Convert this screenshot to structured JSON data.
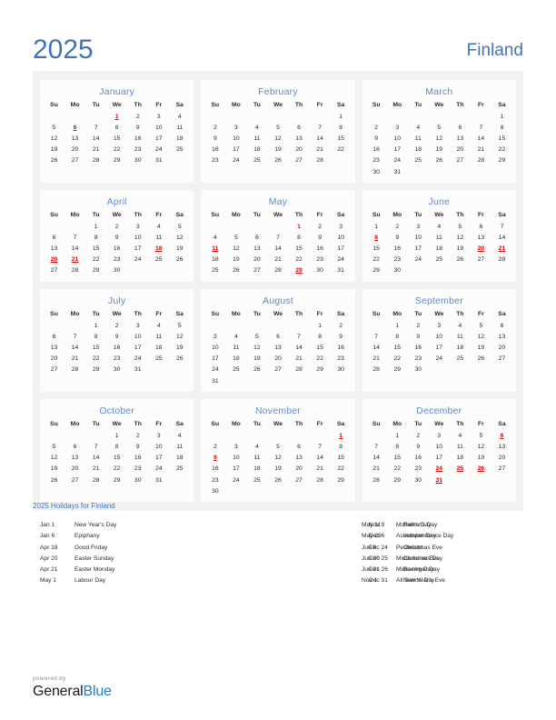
{
  "header": {
    "year": "2025",
    "country": "Finland"
  },
  "weekdays": [
    "Su",
    "Mo",
    "Tu",
    "We",
    "Th",
    "Fr",
    "Sa"
  ],
  "months": [
    {
      "name": "January",
      "weeks": [
        [
          "",
          "",
          "",
          "1",
          "2",
          "3",
          "4"
        ],
        [
          "5",
          "6",
          "7",
          "8",
          "9",
          "10",
          "11"
        ],
        [
          "12",
          "13",
          "14",
          "15",
          "16",
          "17",
          "18"
        ],
        [
          "19",
          "20",
          "21",
          "22",
          "23",
          "24",
          "25"
        ],
        [
          "26",
          "27",
          "28",
          "29",
          "30",
          "31",
          ""
        ]
      ],
      "holidays": [
        "1",
        "6"
      ],
      "holidays_plain": []
    },
    {
      "name": "February",
      "weeks": [
        [
          "",
          "",
          "",
          "",
          "",
          "",
          "1"
        ],
        [
          "2",
          "3",
          "4",
          "5",
          "6",
          "7",
          "8"
        ],
        [
          "9",
          "10",
          "11",
          "12",
          "13",
          "14",
          "15"
        ],
        [
          "16",
          "17",
          "18",
          "19",
          "20",
          "21",
          "22"
        ],
        [
          "23",
          "24",
          "25",
          "26",
          "27",
          "28",
          ""
        ]
      ],
      "holidays": [],
      "holidays_plain": []
    },
    {
      "name": "March",
      "weeks": [
        [
          "",
          "",
          "",
          "",
          "",
          "",
          "1"
        ],
        [
          "2",
          "3",
          "4",
          "5",
          "6",
          "7",
          "8"
        ],
        [
          "9",
          "10",
          "11",
          "12",
          "13",
          "14",
          "15"
        ],
        [
          "16",
          "17",
          "18",
          "19",
          "20",
          "21",
          "22"
        ],
        [
          "23",
          "24",
          "25",
          "26",
          "27",
          "28",
          "29"
        ],
        [
          "30",
          "31",
          "",
          "",
          "",
          "",
          ""
        ]
      ],
      "holidays": [],
      "holidays_plain": []
    },
    {
      "name": "April",
      "weeks": [
        [
          "",
          "",
          "1",
          "2",
          "3",
          "4",
          "5"
        ],
        [
          "6",
          "7",
          "8",
          "9",
          "10",
          "11",
          "12"
        ],
        [
          "13",
          "14",
          "15",
          "16",
          "17",
          "18",
          "19"
        ],
        [
          "20",
          "21",
          "22",
          "23",
          "24",
          "25",
          "26"
        ],
        [
          "27",
          "28",
          "29",
          "30",
          "",
          "",
          ""
        ]
      ],
      "holidays": [
        "18",
        "20",
        "21"
      ],
      "holidays_plain": []
    },
    {
      "name": "May",
      "weeks": [
        [
          "",
          "",
          "",
          "",
          "1",
          "2",
          "3"
        ],
        [
          "4",
          "5",
          "6",
          "7",
          "8",
          "9",
          "10"
        ],
        [
          "11",
          "12",
          "13",
          "14",
          "15",
          "16",
          "17"
        ],
        [
          "18",
          "19",
          "20",
          "21",
          "22",
          "23",
          "24"
        ],
        [
          "25",
          "26",
          "27",
          "28",
          "29",
          "30",
          "31"
        ]
      ],
      "holidays": [
        "11",
        "29"
      ],
      "holidays_plain": [
        "1"
      ]
    },
    {
      "name": "June",
      "weeks": [
        [
          "1",
          "2",
          "3",
          "4",
          "5",
          "6",
          "7"
        ],
        [
          "8",
          "9",
          "10",
          "11",
          "12",
          "13",
          "14"
        ],
        [
          "15",
          "16",
          "17",
          "18",
          "19",
          "20",
          "21"
        ],
        [
          "22",
          "23",
          "24",
          "25",
          "26",
          "27",
          "28"
        ],
        [
          "29",
          "30",
          "",
          "",
          "",
          "",
          ""
        ]
      ],
      "holidays": [
        "8",
        "20",
        "21"
      ],
      "holidays_plain": []
    },
    {
      "name": "July",
      "weeks": [
        [
          "",
          "",
          "1",
          "2",
          "3",
          "4",
          "5"
        ],
        [
          "6",
          "7",
          "8",
          "9",
          "10",
          "11",
          "12"
        ],
        [
          "13",
          "14",
          "15",
          "16",
          "17",
          "18",
          "19"
        ],
        [
          "20",
          "21",
          "22",
          "23",
          "24",
          "25",
          "26"
        ],
        [
          "27",
          "28",
          "29",
          "30",
          "31",
          "",
          ""
        ]
      ],
      "holidays": [],
      "holidays_plain": []
    },
    {
      "name": "August",
      "weeks": [
        [
          "",
          "",
          "",
          "",
          "",
          "1",
          "2"
        ],
        [
          "3",
          "4",
          "5",
          "6",
          "7",
          "8",
          "9"
        ],
        [
          "10",
          "11",
          "12",
          "13",
          "14",
          "15",
          "16"
        ],
        [
          "17",
          "18",
          "19",
          "20",
          "21",
          "22",
          "23"
        ],
        [
          "24",
          "25",
          "26",
          "27",
          "28",
          "29",
          "30"
        ],
        [
          "31",
          "",
          "",
          "",
          "",
          "",
          ""
        ]
      ],
      "holidays": [],
      "holidays_plain": []
    },
    {
      "name": "September",
      "weeks": [
        [
          "",
          "1",
          "2",
          "3",
          "4",
          "5",
          "6"
        ],
        [
          "7",
          "8",
          "9",
          "10",
          "11",
          "12",
          "13"
        ],
        [
          "14",
          "15",
          "16",
          "17",
          "18",
          "19",
          "20"
        ],
        [
          "21",
          "22",
          "23",
          "24",
          "25",
          "26",
          "27"
        ],
        [
          "28",
          "29",
          "30",
          "",
          "",
          "",
          ""
        ]
      ],
      "holidays": [],
      "holidays_plain": []
    },
    {
      "name": "October",
      "weeks": [
        [
          "",
          "",
          "",
          "1",
          "2",
          "3",
          "4"
        ],
        [
          "5",
          "6",
          "7",
          "8",
          "9",
          "10",
          "11"
        ],
        [
          "12",
          "13",
          "14",
          "15",
          "16",
          "17",
          "18"
        ],
        [
          "19",
          "20",
          "21",
          "22",
          "23",
          "24",
          "25"
        ],
        [
          "26",
          "27",
          "28",
          "29",
          "30",
          "31",
          ""
        ]
      ],
      "holidays": [],
      "holidays_plain": []
    },
    {
      "name": "November",
      "weeks": [
        [
          "",
          "",
          "",
          "",
          "",
          "",
          "1"
        ],
        [
          "2",
          "3",
          "4",
          "5",
          "6",
          "7",
          "8"
        ],
        [
          "9",
          "10",
          "11",
          "12",
          "13",
          "14",
          "15"
        ],
        [
          "16",
          "17",
          "18",
          "19",
          "20",
          "21",
          "22"
        ],
        [
          "23",
          "24",
          "25",
          "26",
          "27",
          "28",
          "29"
        ],
        [
          "30",
          "",
          "",
          "",
          "",
          "",
          ""
        ]
      ],
      "holidays": [
        "1",
        "9"
      ],
      "holidays_plain": []
    },
    {
      "name": "December",
      "weeks": [
        [
          "",
          "1",
          "2",
          "3",
          "4",
          "5",
          "6"
        ],
        [
          "7",
          "8",
          "9",
          "10",
          "11",
          "12",
          "13"
        ],
        [
          "14",
          "15",
          "16",
          "17",
          "18",
          "19",
          "20"
        ],
        [
          "21",
          "22",
          "23",
          "24",
          "25",
          "26",
          "27"
        ],
        [
          "28",
          "29",
          "30",
          "31",
          "",
          "",
          ""
        ]
      ],
      "holidays": [
        "6",
        "24",
        "25",
        "26",
        "31"
      ],
      "holidays_plain": []
    }
  ],
  "holidays_section": {
    "title": "2025 Holidays for Finland",
    "columns": [
      [
        {
          "date": "Jan 1",
          "name": "New Year's Day"
        },
        {
          "date": "Jan 6",
          "name": "Epiphany"
        },
        {
          "date": "Apr 18",
          "name": "Good Friday"
        },
        {
          "date": "Apr 20",
          "name": "Easter Sunday"
        },
        {
          "date": "Apr 21",
          "name": "Easter Monday"
        },
        {
          "date": "May 1",
          "name": "Labour Day"
        }
      ],
      [
        {
          "date": "May 11",
          "name": "Mother's Day"
        },
        {
          "date": "May 29",
          "name": "Ascension Day"
        },
        {
          "date": "Jun 8",
          "name": "Pentecost"
        },
        {
          "date": "Jun 20",
          "name": "Midsummer Eve"
        },
        {
          "date": "Jun 21",
          "name": "Midsummer Day"
        },
        {
          "date": "Nov 1",
          "name": "All Saints' Day"
        }
      ],
      [
        {
          "date": "Nov 9",
          "name": "Father's Day"
        },
        {
          "date": "Dec 6",
          "name": "Independence Day"
        },
        {
          "date": "Dec 24",
          "name": "Christmas Eve"
        },
        {
          "date": "Dec 25",
          "name": "Christmas Day"
        },
        {
          "date": "Dec 26",
          "name": "Boxing Day"
        },
        {
          "date": "Dec 31",
          "name": "New Year's Eve"
        }
      ]
    ]
  },
  "footer": {
    "powered_by": "powered by",
    "brand_first": "General",
    "brand_second": "Blue"
  },
  "colors": {
    "accent_blue": "#4472b8",
    "month_blue": "#5b8bd4",
    "holiday_red": "#e00000",
    "panel_bg": "#f2f2f2",
    "month_bg": "#fcfcfc",
    "brand_blue": "#1a7fc8"
  }
}
